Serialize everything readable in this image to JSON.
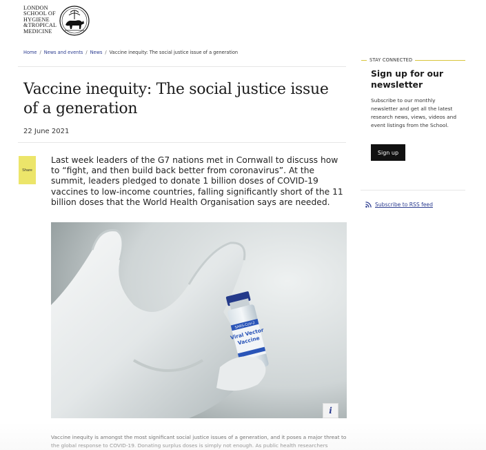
{
  "logo": {
    "lines": [
      "London",
      "School of",
      "Hygiene",
      "&Tropical",
      "Medicine"
    ]
  },
  "breadcrumb": {
    "items": [
      "Home",
      "News and events",
      "News"
    ],
    "current": "Vaccine inequity: The social justice issue of a generation",
    "separator": "/"
  },
  "article": {
    "title": "Vaccine inequity: The social justice issue of a generation",
    "date": "22 June 2021",
    "share_label": "Share",
    "intro": "Last week leaders of the G7 nations met in Cornwall to discuss how to “fight, and then build back better from coronavirus”. At the summit, leaders pledged to donate 1 billion doses of COVID-19 vaccines to low-income countries, falling significantly short of the 11 billion doses that the World Health Organisation says are needed.",
    "image": {
      "vial_label_top": "SARS-CoV-2",
      "vial_label_line1": "Viral Vector",
      "vial_label_line2": "Vaccine",
      "info_label": "i"
    },
    "body": "Vaccine inequity is amongst the most significant social justice issues of a generation, and it poses a major threat to the global response to COVID-19. Donating surplus doses is simply not enough. As public health researchers"
  },
  "sidebar": {
    "stay_label": "STAY CONNECTED",
    "signup_title": "Sign up for our newsletter",
    "signup_desc": "Subscribe to our monthly newsletter and get all the latest research news, views, videos and event listings from the School.",
    "signup_button": "Sign up",
    "rss_label": "Subscribe to RSS feed"
  },
  "colors": {
    "link": "#2a3b8f",
    "share_bg": "#ece56a",
    "accent_line": "#d8c43a",
    "button_bg": "#111111"
  }
}
